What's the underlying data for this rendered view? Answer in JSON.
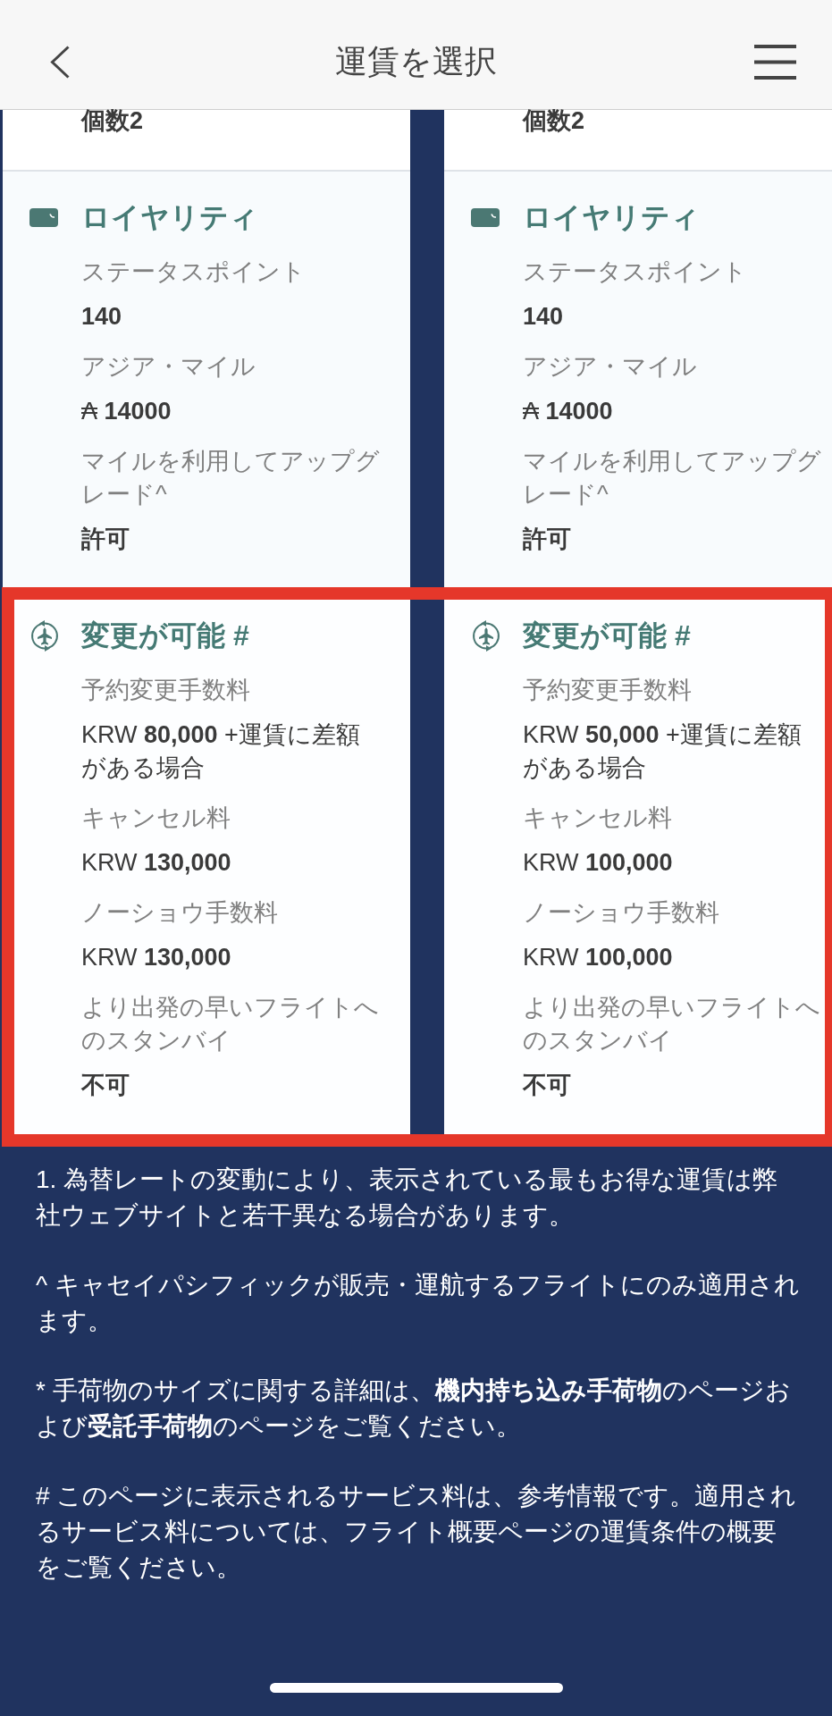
{
  "header": {
    "title": "運賃を選択"
  },
  "rows": [
    {
      "kind": "baggage",
      "highlighted": false,
      "cells": [
        {
          "items": [
            {
              "value": "個数2",
              "bold": true
            }
          ]
        },
        {
          "items": [
            {
              "value": "個数2",
              "bold": true
            }
          ]
        }
      ]
    },
    {
      "kind": "loyalty",
      "highlighted": false,
      "cells": [
        {
          "title": "ロイヤリティ",
          "items": [
            {
              "label": "ステータスポイント",
              "value": "140",
              "bold": true
            },
            {
              "label": "アジア・マイル",
              "value": "₳ **14000**",
              "bold": false
            },
            {
              "label": "マイルを利用してアップグレード^",
              "value": "許可",
              "bold": true
            }
          ]
        },
        {
          "title": "ロイヤリティ",
          "items": [
            {
              "label": "ステータスポイント",
              "value": "140",
              "bold": true
            },
            {
              "label": "アジア・マイル",
              "value": "₳ **14000**",
              "bold": false
            },
            {
              "label": "マイルを利用してアップグレード^",
              "value": "許可",
              "bold": true
            }
          ]
        }
      ]
    },
    {
      "kind": "changes",
      "highlighted": true,
      "cells": [
        {
          "title": "変更が可能 #",
          "items": [
            {
              "label": "予約変更手数料",
              "value": "KRW **80,000** +運賃に差額がある場合",
              "bold": false
            },
            {
              "label": "キャンセル料",
              "value": "KRW **130,000**",
              "bold": false
            },
            {
              "label": "ノーショウ手数料",
              "value": "KRW **130,000**",
              "bold": false
            },
            {
              "label": "より出発の早いフライトへのスタンバイ",
              "value": "不可",
              "bold": true
            }
          ]
        },
        {
          "title": "変更が可能 #",
          "items": [
            {
              "label": "予約変更手数料",
              "value": "KRW **50,000** +運賃に差額がある場合",
              "bold": false
            },
            {
              "label": "キャンセル料",
              "value": "KRW **100,000**",
              "bold": false
            },
            {
              "label": "ノーショウ手数料",
              "value": "KRW **100,000**",
              "bold": false
            },
            {
              "label": "より出発の早いフライトへのスタンバイ",
              "value": "不可",
              "bold": true
            }
          ]
        }
      ]
    }
  ],
  "footnotes": [
    "1. 為替レートの変動により、表示されている最もお得な運賃は弊社ウェブサイトと若干異なる場合があります。",
    "^ キャセイパシフィックが販売・運航するフライトにのみ適用されます。",
    "* 手荷物のサイズに関する詳細は、**機内持ち込み手荷物**のページおよび**受託手荷物**のページをご覧ください。",
    "# このページに表示されるサービス料は、参考情報です。適用されるサービス料については、フライト概要ページの運賃条件の概要をご覧ください。"
  ]
}
